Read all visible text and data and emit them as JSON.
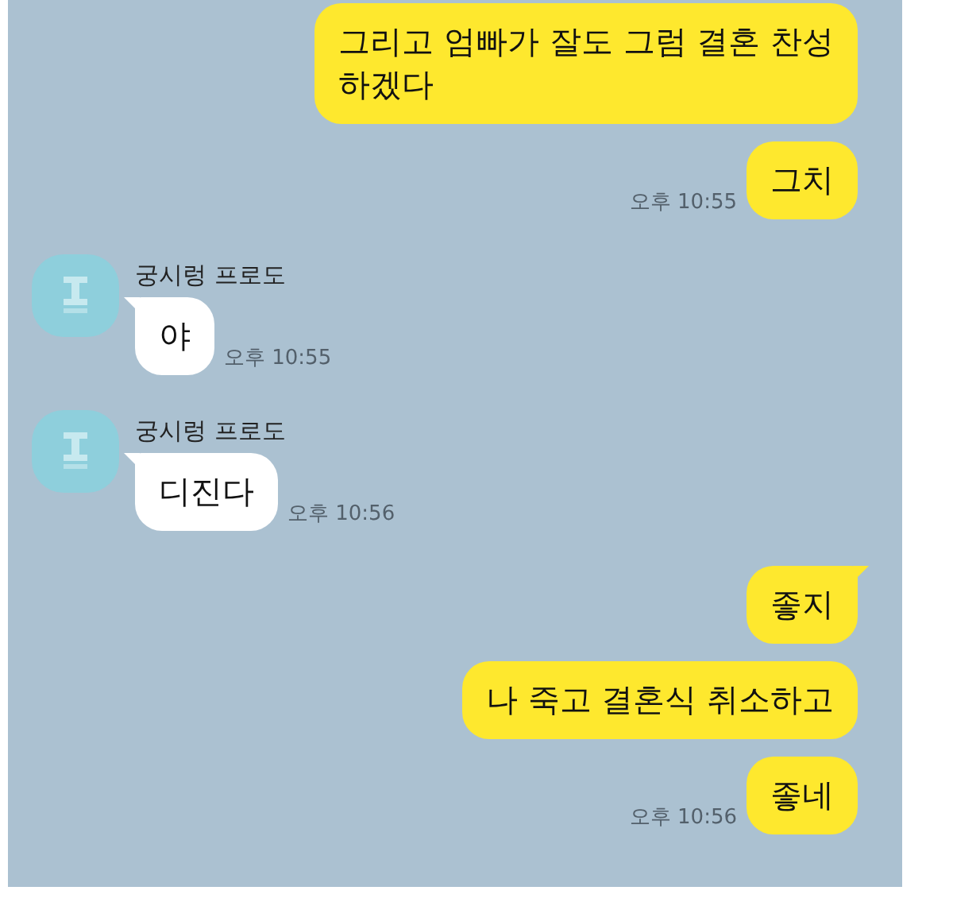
{
  "messages": [
    {
      "kind": "sent",
      "text": "그리고 엄빠가 잘도 그럼 결혼 찬성\n하겠다",
      "tail": false
    },
    {
      "kind": "sent",
      "text": "그치",
      "time": "오후 10:55",
      "tail": false
    },
    {
      "kind": "received",
      "sender": "궁시렁 프로도",
      "text": "야",
      "time": "오후 10:55",
      "tail": true
    },
    {
      "kind": "received",
      "sender": "궁시렁 프로도",
      "text": "디진다",
      "time": "오후 10:56",
      "tail": true
    },
    {
      "kind": "sent",
      "text": "좋지",
      "tail": true
    },
    {
      "kind": "sent",
      "text": "나 죽고 결혼식 취소하고",
      "tail": false
    },
    {
      "kind": "sent",
      "text": "좋네",
      "time": "오후 10:56",
      "tail": false
    }
  ]
}
